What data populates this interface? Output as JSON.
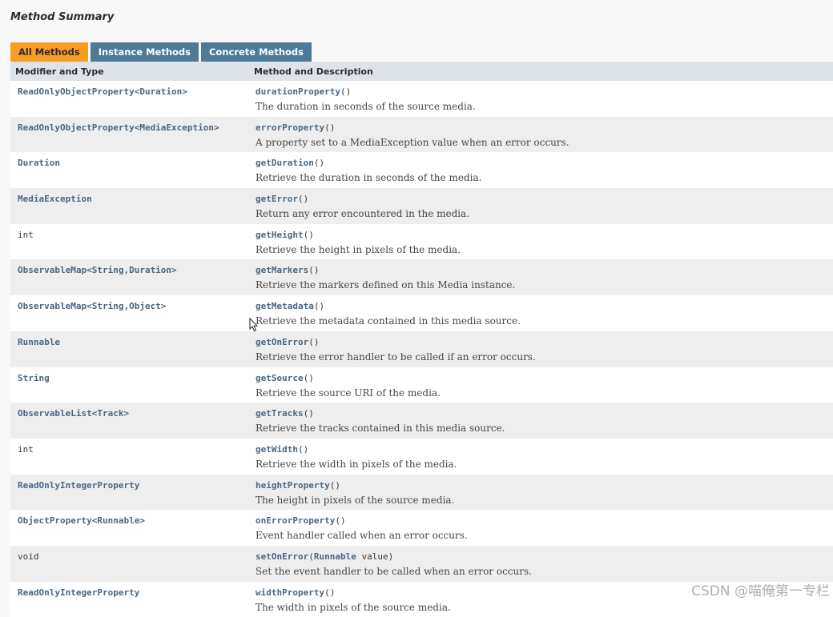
{
  "section_title": "Method Summary",
  "tabs": [
    {
      "label": "All Methods",
      "active": true
    },
    {
      "label": "Instance Methods",
      "active": false
    },
    {
      "label": "Concrete Methods",
      "active": false
    }
  ],
  "table": {
    "headers": {
      "modifier": "Modifier and Type",
      "method": "Method and Description"
    },
    "rows": [
      {
        "type": "ReadOnlyObjectProperty<Duration>",
        "method": "durationProperty",
        "params": "()",
        "description": "The duration in seconds of the source media."
      },
      {
        "type": "ReadOnlyObjectProperty<MediaException>",
        "method": "errorProperty",
        "params": "()",
        "description": "A property set to a MediaException value when an error occurs."
      },
      {
        "type": "Duration",
        "method": "getDuration",
        "params": "()",
        "description": "Retrieve the duration in seconds of the media."
      },
      {
        "type": "MediaException",
        "method": "getError",
        "params": "()",
        "description": "Return any error encountered in the media."
      },
      {
        "type": "int",
        "method": "getHeight",
        "params": "()",
        "description": "Retrieve the height in pixels of the media."
      },
      {
        "type": "ObservableMap<String,Duration>",
        "method": "getMarkers",
        "params": "()",
        "description": "Retrieve the markers defined on this Media instance."
      },
      {
        "type": "ObservableMap<String,Object>",
        "method": "getMetadata",
        "params": "()",
        "description": "Retrieve the metadata contained in this media source."
      },
      {
        "type": "Runnable",
        "method": "getOnError",
        "params": "()",
        "description": "Retrieve the error handler to be called if an error occurs."
      },
      {
        "type": "String",
        "method": "getSource",
        "params": "()",
        "description": "Retrieve the source URI of the media."
      },
      {
        "type": "ObservableList<Track>",
        "method": "getTracks",
        "params": "()",
        "description": "Retrieve the tracks contained in this media source."
      },
      {
        "type": "int",
        "method": "getWidth",
        "params": "()",
        "description": "Retrieve the width in pixels of the media."
      },
      {
        "type": "ReadOnlyIntegerProperty",
        "method": "heightProperty",
        "params": "()",
        "description": "The height in pixels of the source media."
      },
      {
        "type": "ObjectProperty<Runnable>",
        "method": "onErrorProperty",
        "params": "()",
        "description": "Event handler called when an error occurs."
      },
      {
        "type": "void",
        "method": "setOnError",
        "params_prefix": "(",
        "param_type": "Runnable",
        "param_name": " value)",
        "description": "Set the event handler to be called when an error occurs."
      },
      {
        "type": "ReadOnlyIntegerProperty",
        "method": "widthProperty",
        "params": "()",
        "description": "The width in pixels of the source media."
      }
    ]
  },
  "watermark": "CSDN @喵俺第一专栏",
  "colors": {
    "active_tab": "#f89d24",
    "inactive_tab": "#4d7a97",
    "link": "#4a6782",
    "header_bg": "#dee3e9"
  }
}
